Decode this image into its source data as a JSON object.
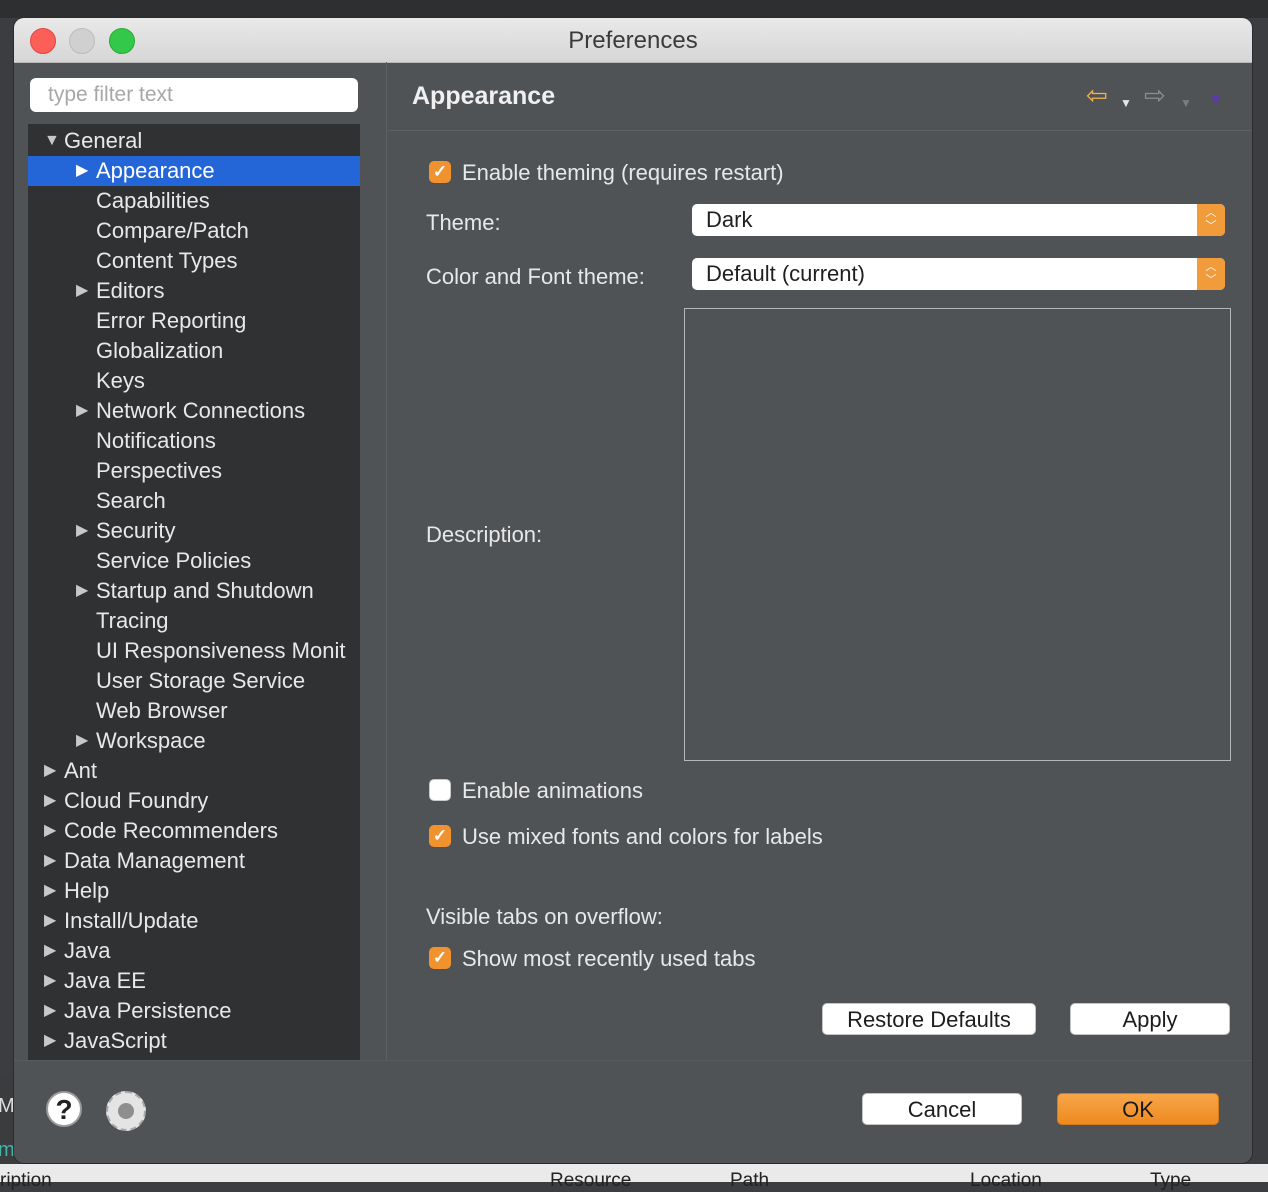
{
  "window": {
    "title": "Preferences"
  },
  "filter": {
    "placeholder": "type filter text"
  },
  "tree": {
    "items": [
      {
        "label": "General",
        "expander": "▼",
        "indent": 0
      },
      {
        "label": "Appearance",
        "expander": "▶",
        "indent": 1,
        "selected": true
      },
      {
        "label": "Capabilities",
        "expander": "",
        "indent": 1
      },
      {
        "label": "Compare/Patch",
        "expander": "",
        "indent": 1
      },
      {
        "label": "Content Types",
        "expander": "",
        "indent": 1
      },
      {
        "label": "Editors",
        "expander": "▶",
        "indent": 1
      },
      {
        "label": "Error Reporting",
        "expander": "",
        "indent": 1
      },
      {
        "label": "Globalization",
        "expander": "",
        "indent": 1
      },
      {
        "label": "Keys",
        "expander": "",
        "indent": 1
      },
      {
        "label": "Network Connections",
        "expander": "▶",
        "indent": 1
      },
      {
        "label": "Notifications",
        "expander": "",
        "indent": 1
      },
      {
        "label": "Perspectives",
        "expander": "",
        "indent": 1
      },
      {
        "label": "Search",
        "expander": "",
        "indent": 1
      },
      {
        "label": "Security",
        "expander": "▶",
        "indent": 1
      },
      {
        "label": "Service Policies",
        "expander": "",
        "indent": 1
      },
      {
        "label": "Startup and Shutdown",
        "expander": "▶",
        "indent": 1
      },
      {
        "label": "Tracing",
        "expander": "",
        "indent": 1
      },
      {
        "label": "UI Responsiveness Monit",
        "expander": "",
        "indent": 1
      },
      {
        "label": "User Storage Service",
        "expander": "",
        "indent": 1
      },
      {
        "label": "Web Browser",
        "expander": "",
        "indent": 1
      },
      {
        "label": "Workspace",
        "expander": "▶",
        "indent": 1
      },
      {
        "label": "Ant",
        "expander": "▶",
        "indent": 0
      },
      {
        "label": "Cloud Foundry",
        "expander": "▶",
        "indent": 0
      },
      {
        "label": "Code Recommenders",
        "expander": "▶",
        "indent": 0
      },
      {
        "label": "Data Management",
        "expander": "▶",
        "indent": 0
      },
      {
        "label": "Help",
        "expander": "▶",
        "indent": 0
      },
      {
        "label": "Install/Update",
        "expander": "▶",
        "indent": 0
      },
      {
        "label": "Java",
        "expander": "▶",
        "indent": 0
      },
      {
        "label": "Java EE",
        "expander": "▶",
        "indent": 0
      },
      {
        "label": "Java Persistence",
        "expander": "▶",
        "indent": 0
      },
      {
        "label": "JavaScript",
        "expander": "▶",
        "indent": 0
      }
    ]
  },
  "page": {
    "title": "Appearance",
    "nav": {
      "back_icon": "back-arrow-icon",
      "forward_icon": "forward-arrow-icon",
      "back_glyph": "⇦",
      "forward_glyph": "⇨",
      "dropdown_glyph": "▼",
      "menu_glyph": "▼"
    },
    "enable_theming": {
      "label": "Enable theming (requires restart)",
      "checked": true
    },
    "theme": {
      "label": "Theme:",
      "value": "Dark"
    },
    "color_font_theme": {
      "label": "Color and Font theme:",
      "value": "Default (current)"
    },
    "description": {
      "label": "Description:",
      "value": ""
    },
    "enable_animations": {
      "label": "Enable animations",
      "checked": false
    },
    "mixed_fonts": {
      "label": "Use mixed fonts and colors for labels",
      "checked": true
    },
    "visible_tabs": {
      "label": "Visible tabs on overflow:"
    },
    "recent_tabs": {
      "label": "Show most recently used tabs",
      "checked": true
    },
    "restore_defaults": "Restore Defaults",
    "apply": "Apply"
  },
  "footer": {
    "help_icon": "help-icon",
    "help_glyph": "?",
    "import_icon": "import-export-icon",
    "cancel": "Cancel",
    "ok": "OK"
  },
  "background": {
    "left_text_1": "Ma",
    "left_text_2": "m",
    "columns": [
      "ription",
      "Resource",
      "Path",
      "Location",
      "Type"
    ]
  },
  "colors": {
    "accent": "#f0922e",
    "selection": "#2465d8",
    "panel": "#505356",
    "tree_bg": "#2f3133"
  }
}
